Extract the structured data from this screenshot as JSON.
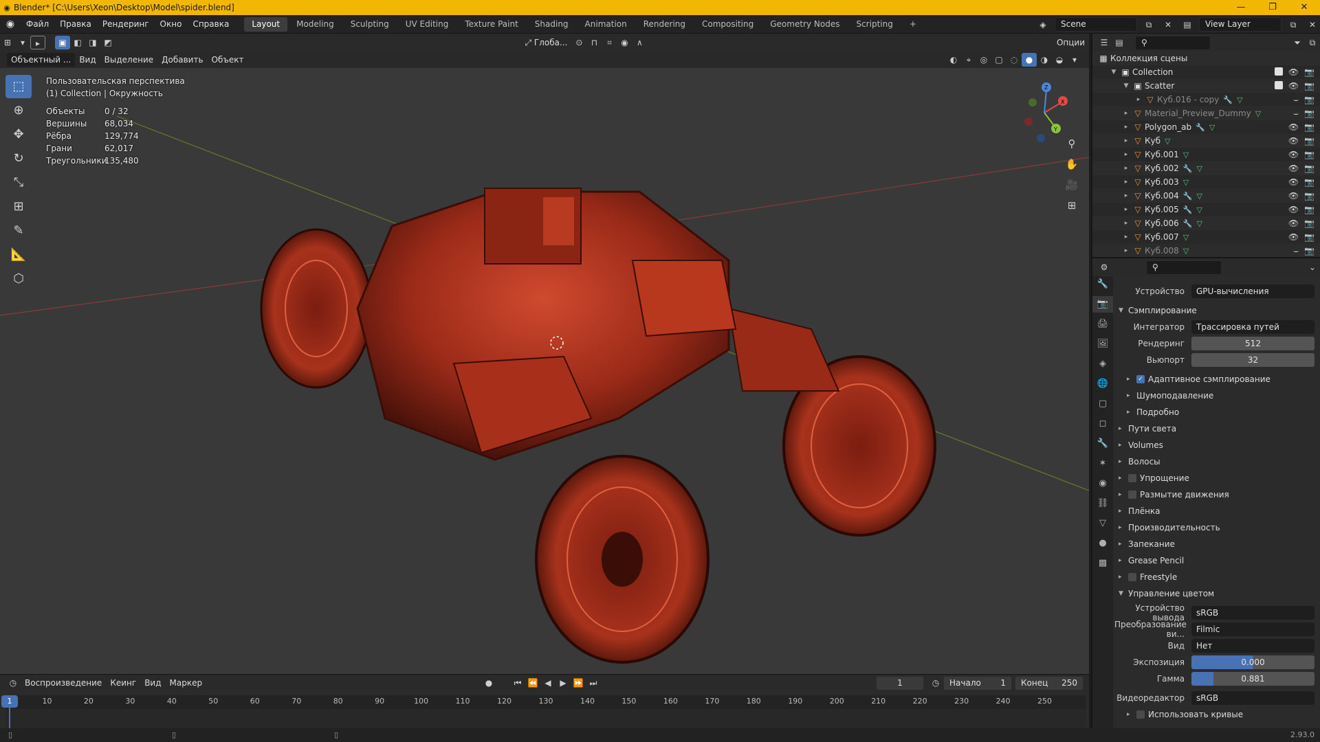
{
  "titlebar": {
    "title": "Blender* [C:\\Users\\Xeon\\Desktop\\Model\\spider.blend]",
    "minimize": "—",
    "maximize": "❐",
    "close": "✕"
  },
  "menu": [
    "Файл",
    "Правка",
    "Рендеринг",
    "Окно",
    "Справка"
  ],
  "workspaces": [
    "Layout",
    "Modeling",
    "Sculpting",
    "UV Editing",
    "Texture Paint",
    "Shading",
    "Animation",
    "Rendering",
    "Compositing",
    "Geometry Nodes",
    "Scripting"
  ],
  "active_workspace": "Layout",
  "scene": {
    "name": "Scene",
    "view_layer": "View Layer"
  },
  "viewport": {
    "mode": "Объектный ...",
    "menus": [
      "Вид",
      "Выделение",
      "Добавить",
      "Объект"
    ],
    "orientation": "Глоба...",
    "options": "Опции",
    "perspective": "Пользовательская перспектива",
    "collection_line": "(1) Collection | Окружность",
    "stats": [
      {
        "label": "Объекты",
        "value": "0 / 32"
      },
      {
        "label": "Вершины",
        "value": "68,034"
      },
      {
        "label": "Рёбра",
        "value": "129,774"
      },
      {
        "label": "Грани",
        "value": "62,017"
      },
      {
        "label": "Треугольники",
        "value": "135,480"
      }
    ],
    "gizmo_labels": {
      "x": "X",
      "y": "Y",
      "z": "Z"
    }
  },
  "timeline": {
    "menus": [
      "Воспроизведение",
      "Кеинг",
      "Вид",
      "Маркер"
    ],
    "current_frame": "1",
    "start_label": "Начало",
    "start": "1",
    "end_label": "Конец",
    "end": "250",
    "ticks": [
      "10",
      "20",
      "30",
      "40",
      "50",
      "60",
      "70",
      "80",
      "90",
      "100",
      "110",
      "120",
      "130",
      "140",
      "150",
      "160",
      "170",
      "180",
      "190",
      "200",
      "210",
      "220",
      "230",
      "240",
      "250"
    ],
    "playhead_frame": 1,
    "frame_min": 0,
    "frame_max": 260
  },
  "status": {
    "version": "2.93.0"
  },
  "outliner": {
    "root": "Коллекция сцены",
    "items": [
      {
        "name": "Collection",
        "depth": 1,
        "icon": "collection",
        "dim": false,
        "mod": false,
        "mesh": false
      },
      {
        "name": "Scatter",
        "depth": 2,
        "icon": "collection",
        "dim": false,
        "mod": false,
        "mesh": false
      },
      {
        "name": "Куб.016 - copy",
        "depth": 3,
        "icon": "object",
        "dim": true,
        "mod": true,
        "mesh": true
      },
      {
        "name": "Material_Preview_Dummy",
        "depth": 2,
        "icon": "object",
        "dim": true,
        "mod": false,
        "mesh": true
      },
      {
        "name": "Polygon_ab",
        "depth": 2,
        "icon": "object",
        "dim": false,
        "mod": true,
        "mesh": true
      },
      {
        "name": "Куб",
        "depth": 2,
        "icon": "object",
        "dim": false,
        "mod": false,
        "mesh": true
      },
      {
        "name": "Куб.001",
        "depth": 2,
        "icon": "object",
        "dim": false,
        "mod": false,
        "mesh": true
      },
      {
        "name": "Куб.002",
        "depth": 2,
        "icon": "object",
        "dim": false,
        "mod": true,
        "mesh": true
      },
      {
        "name": "Куб.003",
        "depth": 2,
        "icon": "object",
        "dim": false,
        "mod": false,
        "mesh": true
      },
      {
        "name": "Куб.004",
        "depth": 2,
        "icon": "object",
        "dim": false,
        "mod": true,
        "mesh": true
      },
      {
        "name": "Куб.005",
        "depth": 2,
        "icon": "object",
        "dim": false,
        "mod": true,
        "mesh": true
      },
      {
        "name": "Куб.006",
        "depth": 2,
        "icon": "object",
        "dim": false,
        "mod": true,
        "mesh": true
      },
      {
        "name": "Куб.007",
        "depth": 2,
        "icon": "object",
        "dim": false,
        "mod": false,
        "mesh": true
      },
      {
        "name": "Куб.008",
        "depth": 2,
        "icon": "object",
        "dim": true,
        "mod": false,
        "mesh": true
      }
    ]
  },
  "properties": {
    "device_label": "Устройство",
    "device": "GPU-вычисления",
    "sampling": "Сэмплирование",
    "integrator_label": "Интегратор",
    "integrator": "Трассировка путей",
    "render_label": "Рендеринг",
    "render_samples": "512",
    "viewport_label": "Вьюпорт",
    "viewport_samples": "32",
    "adaptive": "Адаптивное сэмплирование",
    "denoise": "Шумоподавление",
    "advanced": "Подробно",
    "sections": [
      "Пути света",
      "Volumes",
      "Волосы",
      "Упрощение",
      "Размытие движения",
      "Плёнка",
      "Производительность",
      "Запекание",
      "Grease Pencil",
      "Freestyle"
    ],
    "checkbox_sections": [
      "Упрощение",
      "Размытие движения",
      "Freestyle"
    ],
    "color_mgmt": "Управление цветом",
    "display_device_label": "Устройство вывода",
    "display_device": "sRGB",
    "view_transform_label": "Преобразование ви...",
    "view_transform": "Filmic",
    "look_label": "Вид",
    "look": "Нет",
    "exposure_label": "Экспозиция",
    "exposure": "0.000",
    "gamma_label": "Гамма",
    "gamma": "0.881",
    "sequencer_label": "Видеоредактор",
    "sequencer": "sRGB",
    "curves": "Использовать кривые"
  },
  "colors": {
    "accent": "#4772b3",
    "titlebar": "#f2b705",
    "model": "#b8321e"
  }
}
